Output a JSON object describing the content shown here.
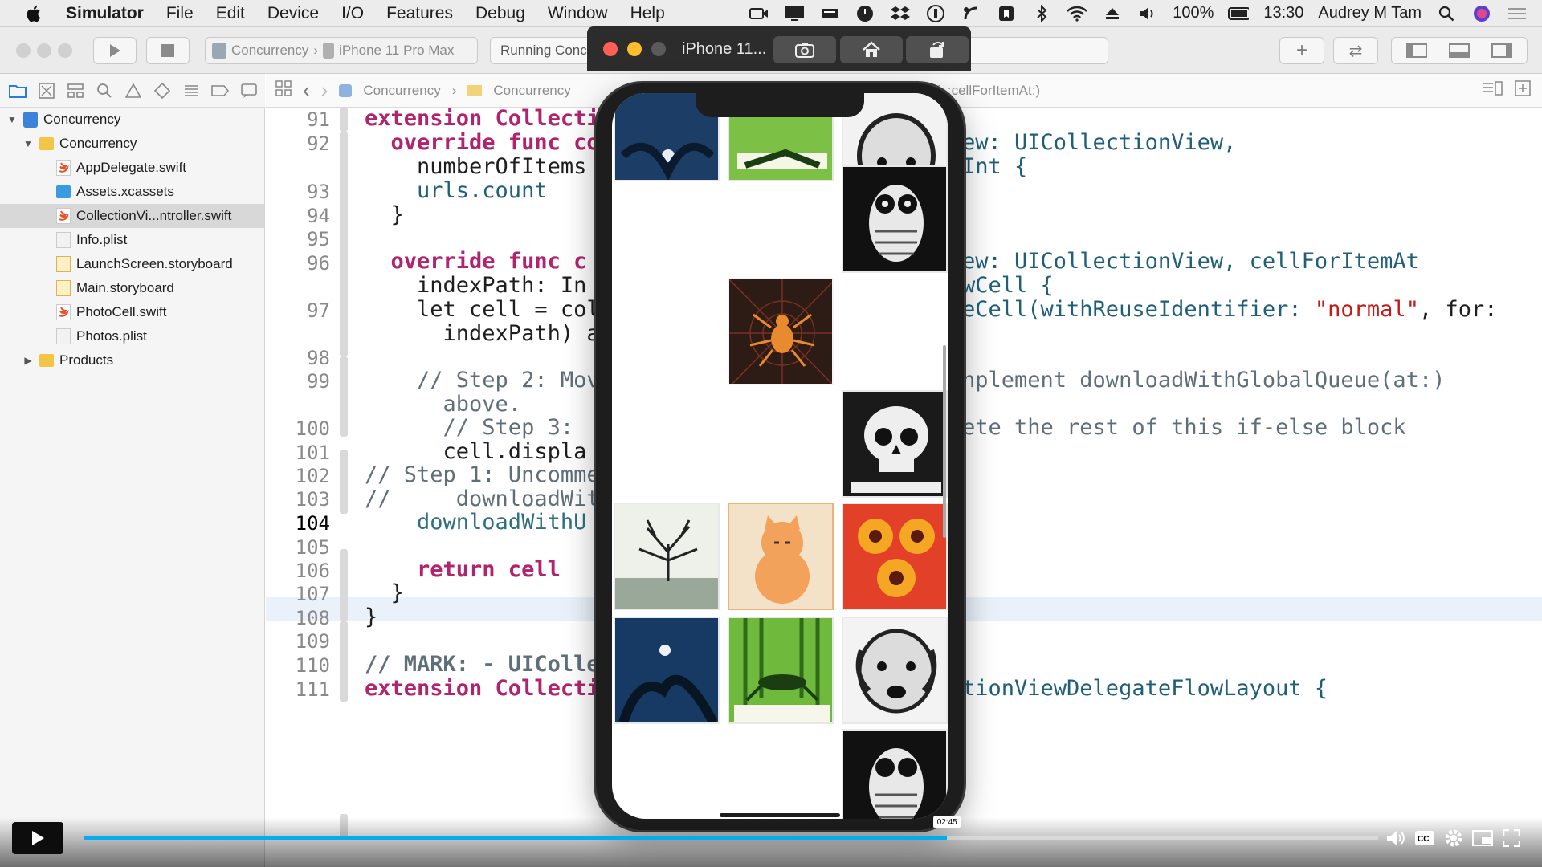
{
  "menubar": {
    "app_name": "Simulator",
    "items": [
      "File",
      "Edit",
      "Device",
      "I/O",
      "Features",
      "Debug",
      "Window",
      "Help"
    ],
    "battery": "100%",
    "time": "13:30",
    "user": "Audrey M Tam"
  },
  "toolbar": {
    "scheme": "Concurrency",
    "device": "iPhone 11 Pro Max",
    "activity": "Running Conc"
  },
  "simulator": {
    "title": "iPhone 11..."
  },
  "jumpbar": {
    "crumb1": "Concurrency",
    "crumb2": "Concurrency",
    "crumb_end": "(_:cellForItemAt:)"
  },
  "navigator": {
    "items": [
      {
        "label": "Concurrency",
        "level": 0,
        "kind": "project"
      },
      {
        "label": "Concurrency",
        "level": 1,
        "kind": "folder"
      },
      {
        "label": "AppDelegate.swift",
        "level": 2,
        "kind": "swift"
      },
      {
        "label": "Assets.xcassets",
        "level": 2,
        "kind": "assets"
      },
      {
        "label": "CollectionVi...ntroller.swift",
        "level": 2,
        "kind": "swift"
      },
      {
        "label": "Info.plist",
        "level": 2,
        "kind": "plist"
      },
      {
        "label": "LaunchScreen.storyboard",
        "level": 2,
        "kind": "storyboard"
      },
      {
        "label": "Main.storyboard",
        "level": 2,
        "kind": "storyboard"
      },
      {
        "label": "PhotoCell.swift",
        "level": 2,
        "kind": "swift"
      },
      {
        "label": "Photos.plist",
        "level": 2,
        "kind": "plist"
      },
      {
        "label": "Products",
        "level": 1,
        "kind": "folder"
      }
    ]
  },
  "editor": {
    "line_numbers": [
      "91",
      "92",
      "93",
      "94",
      "95",
      "96",
      "97",
      "98",
      "99",
      "100",
      "101",
      "102",
      "103",
      "104",
      "105",
      "106",
      "107",
      "108",
      "109",
      "110",
      "111"
    ],
    "current_line": "104",
    "lines": {
      "l91": "extension Collecti",
      "l92a": "  override func co",
      "l92b": "ew: UICollectionView,",
      "l92c": "    numberOfItems",
      "l92d": "Int {",
      "l93": "    urls.count",
      "l94": "  }",
      "l96a": "  override func c",
      "l96b": "ew: UICollectionView, cellForItemAt",
      "l96c": "    indexPath: In",
      "l96d": "wCell {",
      "l97a": "    let cell = col",
      "l97b": "eCell(withReuseIdentifier: ",
      "l97s": "\"normal\"",
      "l97e": ", for:",
      "l97c": "      indexPath) a",
      "l99a": "    // Step 2: Mov",
      "l99b": "nplement downloadWithGlobalQueue(at:)",
      "l99c": "      above.",
      "l100a": "      // Step 3: ",
      "l100b": "ete the rest of this if-else block",
      "l101": "      cell.displa",
      "l102": "// Step 1: Uncomme",
      "l103": "//     downloadWit",
      "l104": "    downloadWithU",
      "l106": "    return cell",
      "l107": "  }",
      "l108": "}",
      "l110": "// MARK: - UIColle",
      "l111a": "extension Collecti",
      "l111b": "tionViewDelegateFlowLayout {"
    }
  },
  "player": {
    "time_label": "02:45",
    "progress": 0.667
  }
}
